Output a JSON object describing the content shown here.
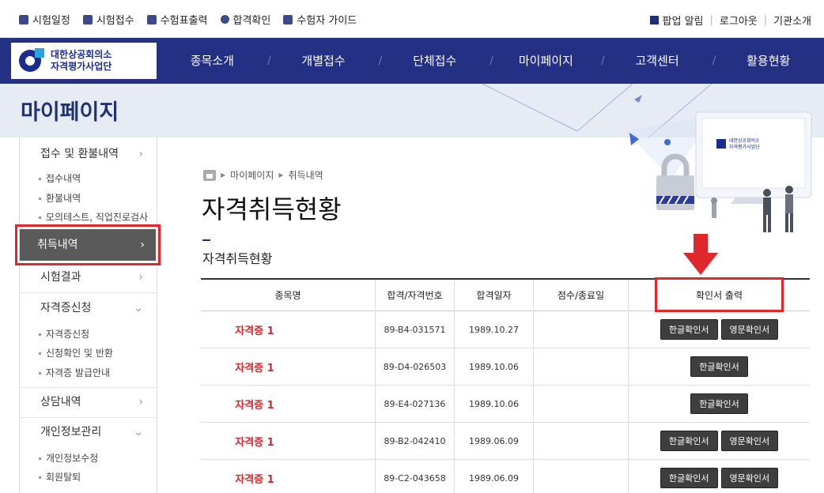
{
  "topbar": {
    "links": [
      {
        "label": "시험일정",
        "icon": "calendar-icon"
      },
      {
        "label": "시험접수",
        "icon": "document-icon"
      },
      {
        "label": "수험표출력",
        "icon": "print-icon"
      },
      {
        "label": "합격확인",
        "icon": "award-icon"
      },
      {
        "label": "수험자 가이드",
        "icon": "book-icon"
      }
    ],
    "right": {
      "popup": "팝업 알림",
      "logout": "로그아웃",
      "about": "기관소개"
    }
  },
  "logo": {
    "line1": "대한상공회의소",
    "line2": "자격평가사업단"
  },
  "nav": [
    "종목소개",
    "개별접수",
    "단체접수",
    "마이페이지",
    "고객센터",
    "활용현황"
  ],
  "subhead": {
    "title": "마이페이지"
  },
  "sidebar": {
    "menu1": "접수 및 환불내역",
    "menu1_subs": [
      "접수내역",
      "환불내역",
      "모의테스트, 직업진로검사"
    ],
    "active": "취득내역",
    "menu3": "시험결과",
    "menu4": "자격증신청",
    "menu4_subs": [
      "자격증신청",
      "신청확인 및 반환",
      "자격증 발급안내"
    ],
    "menu5": "상담내역",
    "menu6": "개인정보관리",
    "menu6_subs": [
      "개인정보수정",
      "회원탈퇴"
    ]
  },
  "breadcrumb": [
    "마이페이지",
    "취득내역"
  ],
  "page_title": "자격취득현황",
  "section_title": "자격취득현황",
  "illus_logo": {
    "line1": "대한상공회의소",
    "line2": "자격평가사업단"
  },
  "table": {
    "headers": [
      "종목명",
      "합격/자격번호",
      "합격일자",
      "점수/종료일",
      "확인서 출력"
    ],
    "rows": [
      {
        "name": "자격증 1",
        "number": "89-B4-031571",
        "date": "1989.10.27",
        "score": "",
        "kor": "한글확인서",
        "eng": "영문확인서"
      },
      {
        "name": "자격증 1",
        "number": "89-D4-026503",
        "date": "1989.10.06",
        "score": "",
        "kor": "한글확인서",
        "eng": ""
      },
      {
        "name": "자격증 1",
        "number": "89-E4-027136",
        "date": "1989.10.06",
        "score": "",
        "kor": "한글확인서",
        "eng": ""
      },
      {
        "name": "자격증 1",
        "number": "89-B2-042410",
        "date": "1989.06.09",
        "score": "",
        "kor": "한글확인서",
        "eng": "영문확인서"
      },
      {
        "name": "자격증 1",
        "number": "89-C2-043658",
        "date": "1989.06.09",
        "score": "",
        "kor": "한글확인서",
        "eng": "영문확인서"
      }
    ]
  },
  "colors": {
    "nav": "#243083",
    "accent_red": "#e0272c",
    "title_blue": "#1f3276"
  }
}
